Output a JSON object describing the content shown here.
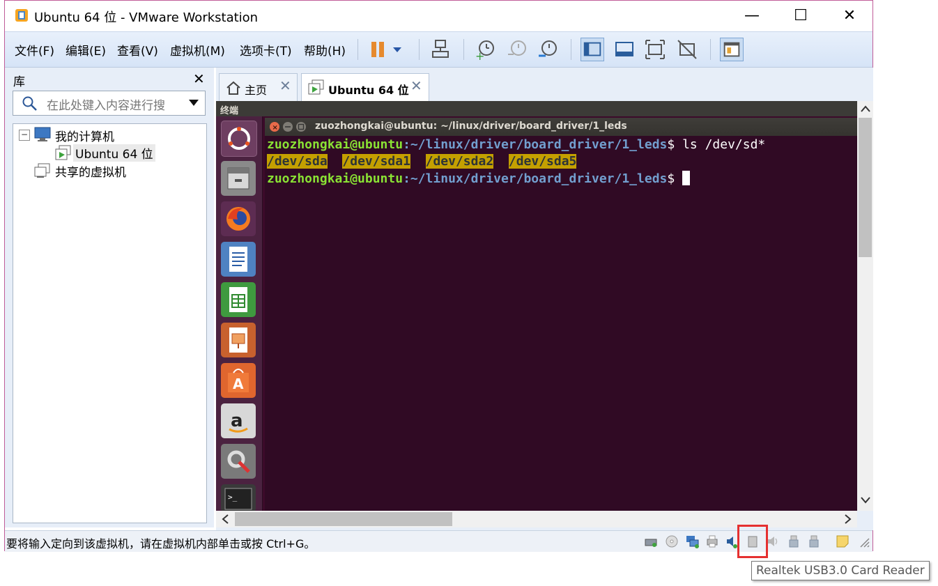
{
  "window": {
    "title": "Ubuntu 64 位 - VMware Workstation",
    "controls": {
      "minimize": "—",
      "maximize": "☐",
      "close": "✕"
    }
  },
  "menubar": {
    "items": [
      "文件(F)",
      "编辑(E)",
      "查看(V)",
      "虚拟机(M)",
      "选项卡(T)",
      "帮助(H)"
    ]
  },
  "library": {
    "title": "库",
    "close": "✕",
    "search_placeholder": "在此处键入内容进行搜",
    "tree": {
      "my_computer": "我的计算机",
      "vm": "Ubuntu 64 位",
      "shared": "共享的虚拟机",
      "collapse": "−"
    }
  },
  "tabs": [
    {
      "label": "主页",
      "close": "✕"
    },
    {
      "label": "Ubuntu 64 位",
      "close": "✕"
    }
  ],
  "ubuntu": {
    "top_bar": "终端",
    "terminal_title": "zuozhongkai@ubuntu: ~/linux/driver/board_driver/1_leds",
    "lines": [
      {
        "user": "zuozhongkai@ubuntu",
        "path": ":~/linux/driver/board_driver/1_leds",
        "prompt": "$ ",
        "cmd": "ls /dev/sd*"
      },
      {
        "outputs": [
          "/dev/sda",
          "/dev/sda1",
          "/dev/sda2",
          "/dev/sda5"
        ]
      },
      {
        "user": "zuozhongkai@ubuntu",
        "path": ":~/linux/driver/board_driver/1_leds",
        "prompt": "$ ",
        "cmd": ""
      }
    ]
  },
  "statusbar": {
    "text": "要将输入定向到该虚拟机，请在虚拟机内部单击或按 Ctrl+G。"
  },
  "tooltip": {
    "text": "Realtek USB3.0 Card Reader"
  },
  "colors": {
    "terminal_bg": "#300a24",
    "prompt_user": "#8ae234",
    "prompt_path": "#729fcf",
    "highlight": "#c4a000",
    "window_border": "#c05c98",
    "callout": "#e53030"
  }
}
